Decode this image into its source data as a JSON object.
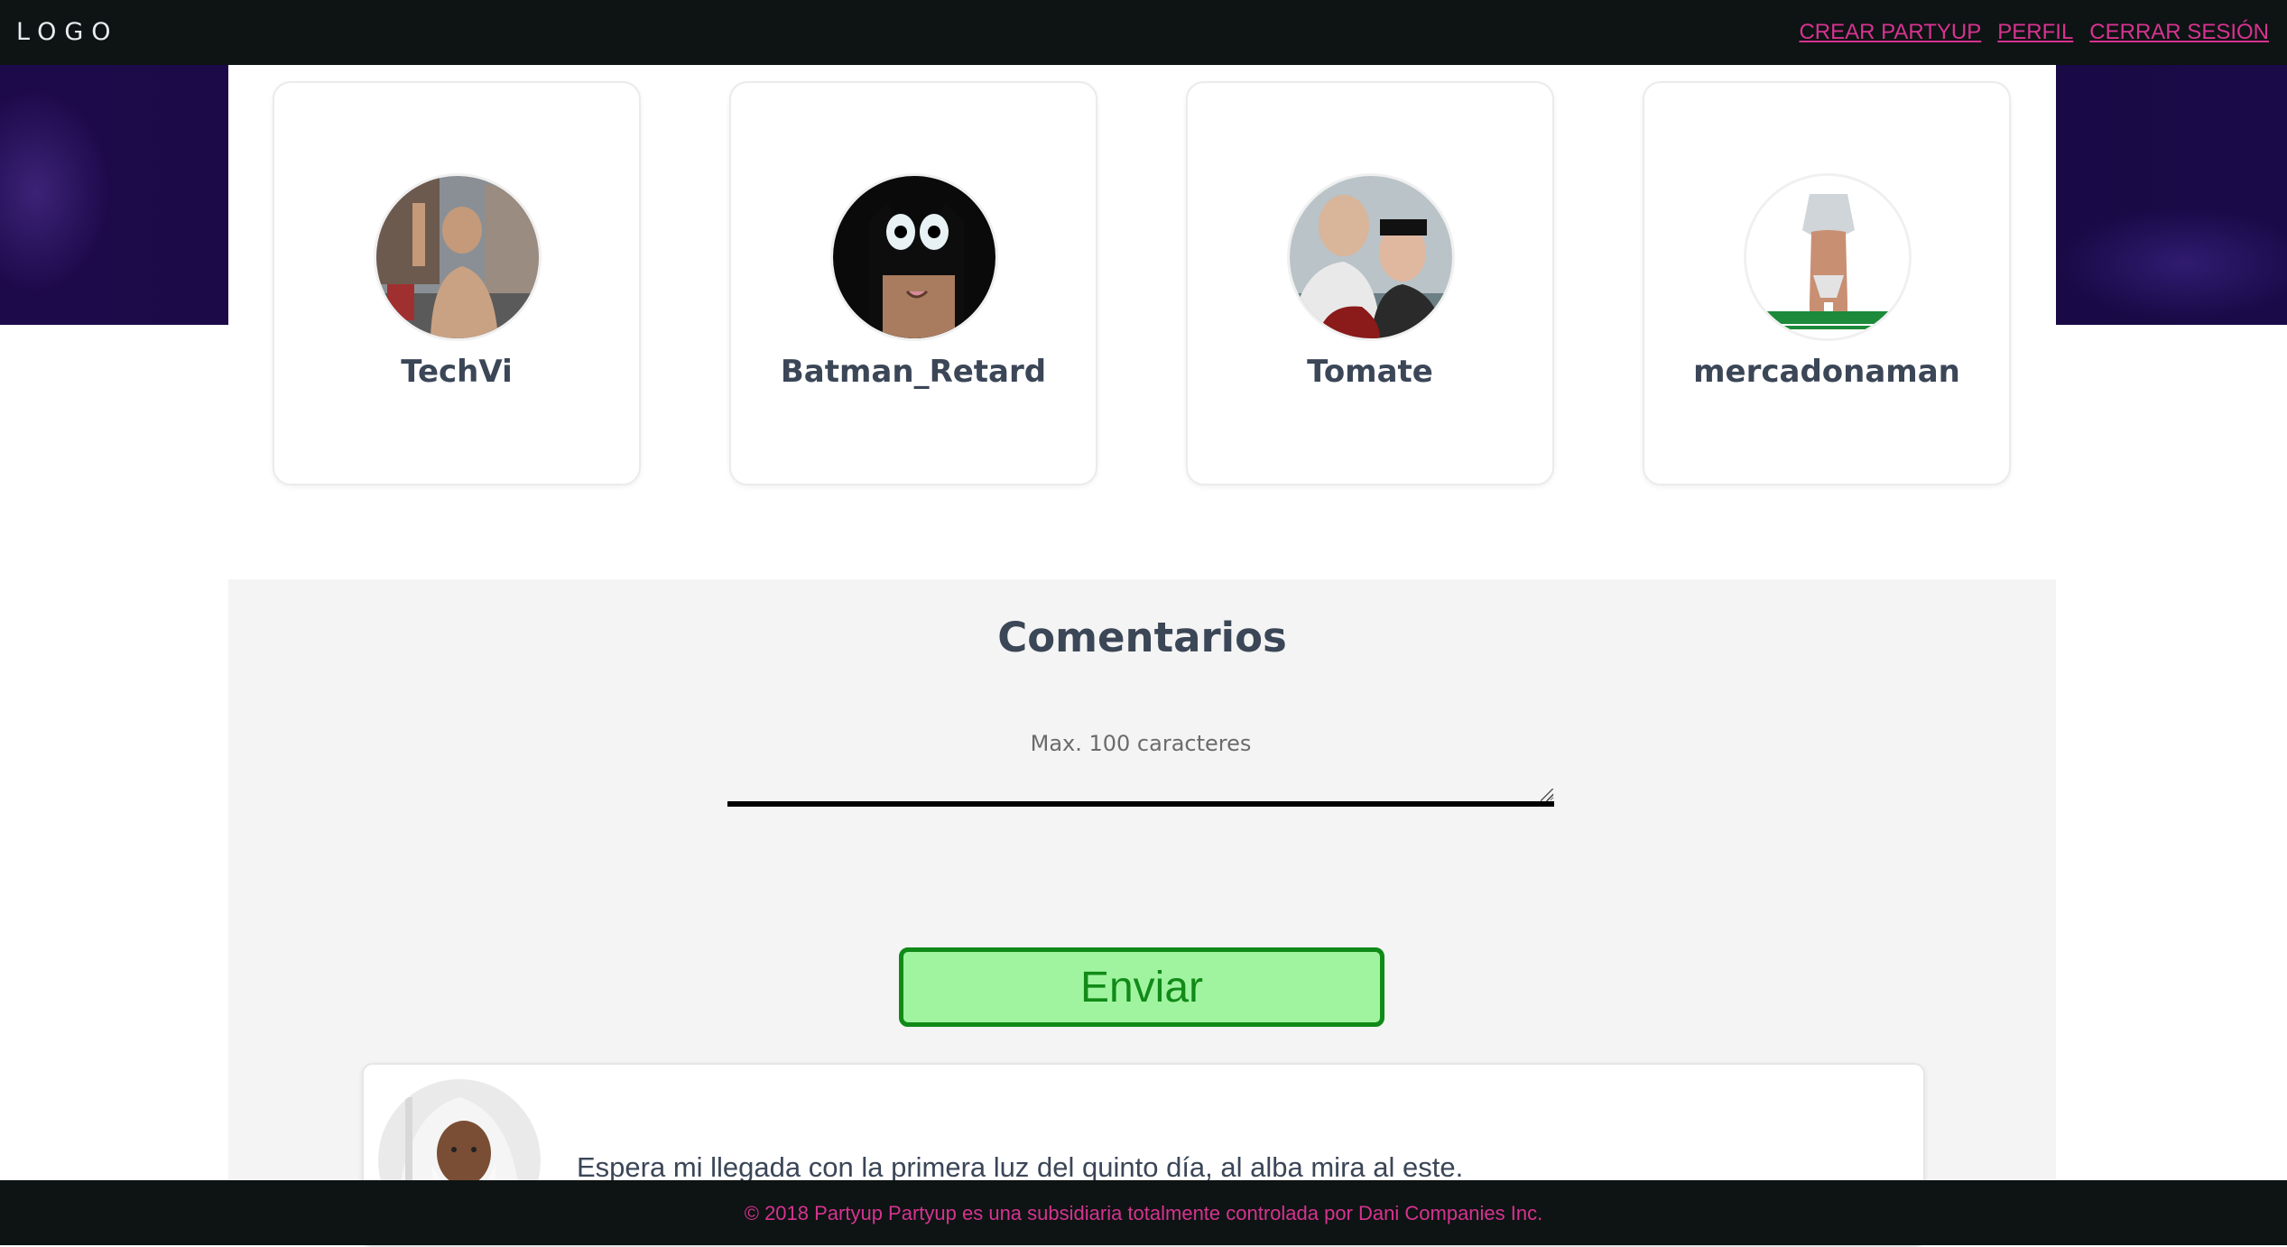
{
  "header": {
    "logo": "LOGO",
    "nav": [
      "CREAR PARTYUP",
      "PERFIL",
      "CERRAR SESIÓN"
    ]
  },
  "members": [
    {
      "name": "TechVi"
    },
    {
      "name": "Batman_Retard"
    },
    {
      "name": "Tomate"
    },
    {
      "name": "mercadonaman"
    }
  ],
  "comments_section": {
    "title": "Comentarios",
    "input_placeholder": "Max. 100 caracteres",
    "send_label": "Enviar",
    "items": [
      {
        "text": "Espera mi llegada con la primera luz del quinto día, al alba mira al este."
      }
    ]
  },
  "footer": {
    "text": "© 2018 Partyup Partyup es una subsidiaria totalmente controlada por Dani Companies Inc."
  },
  "colors": {
    "topbar": "#0e1314",
    "link": "#d6338f",
    "hero": "#1d0a4b",
    "send_bg": "#a0f4a0",
    "send_border": "#118a18"
  }
}
